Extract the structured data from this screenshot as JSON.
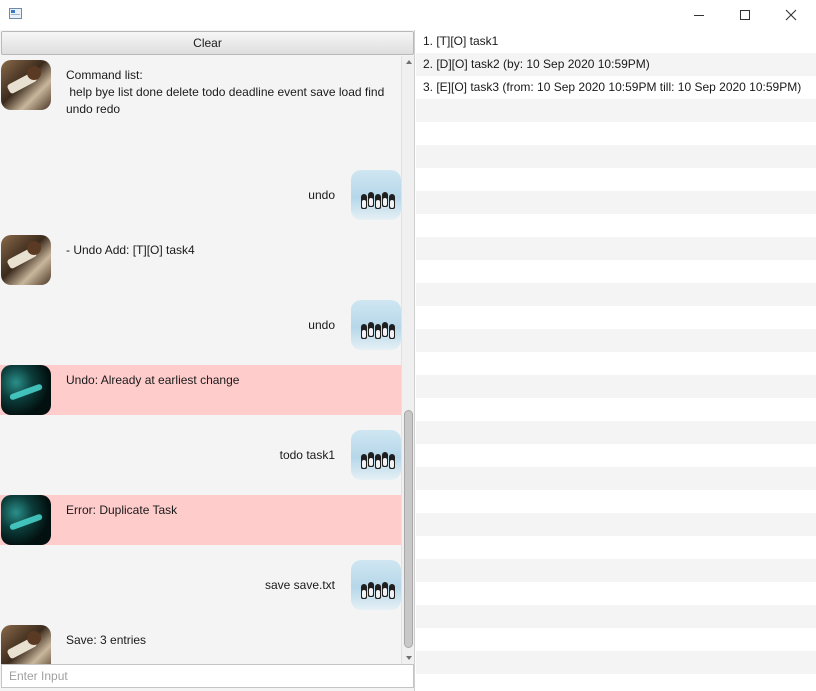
{
  "window": {
    "title": ""
  },
  "window_buttons": {
    "minimize": "minimize-icon",
    "maximize": "maximize-icon",
    "close": "close-icon"
  },
  "toolbar": {
    "clear_label": "Clear"
  },
  "dialog": [
    {
      "sender": "bot",
      "avatar": "duke",
      "error": false,
      "text": "Command list:\n help bye list done delete todo deadline event save load find undo redo"
    },
    {
      "sender": "user",
      "avatar": "penguins",
      "error": false,
      "text": "undo"
    },
    {
      "sender": "bot",
      "avatar": "duke",
      "error": false,
      "text": "- Undo Add: [T][O] task4"
    },
    {
      "sender": "user",
      "avatar": "penguins",
      "error": false,
      "text": "undo"
    },
    {
      "sender": "bot",
      "avatar": "cyan",
      "error": true,
      "text": "Undo: Already at earliest change"
    },
    {
      "sender": "user",
      "avatar": "penguins",
      "error": false,
      "text": "todo task1"
    },
    {
      "sender": "bot",
      "avatar": "cyan",
      "error": true,
      "text": "Error: Duplicate Task"
    },
    {
      "sender": "user",
      "avatar": "penguins",
      "error": false,
      "text": "save save.txt"
    },
    {
      "sender": "bot",
      "avatar": "duke",
      "error": false,
      "text": "Save: 3 entries"
    }
  ],
  "input": {
    "placeholder": "Enter Input",
    "value": ""
  },
  "tasks": [
    "1. [T][O] task1",
    "2. [D][O] task2 (by: 10 Sep 2020 10:59PM)",
    "3. [E][O] task3 (from: 10 Sep 2020 10:59PM till: 10 Sep 2020 10:59PM)"
  ],
  "colors": {
    "error_bg": "#ffcccc",
    "pane_bg": "#f4f4f4",
    "stripe": "#f4f4f4"
  }
}
